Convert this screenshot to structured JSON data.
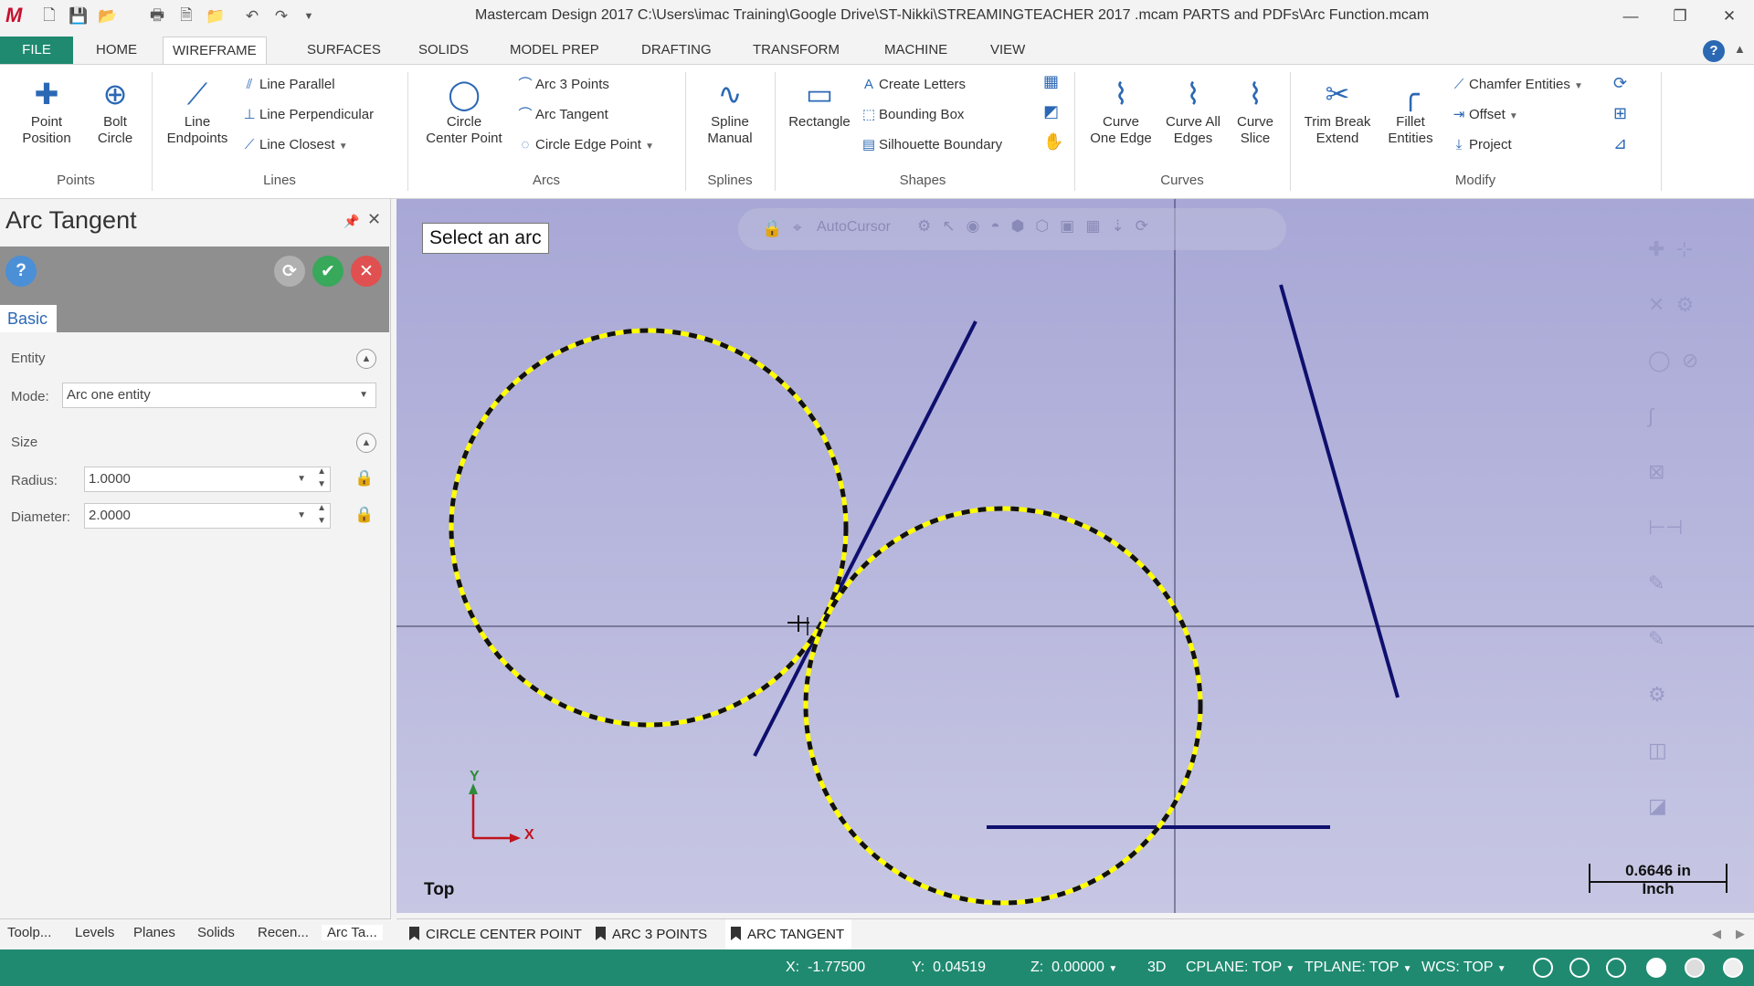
{
  "window": {
    "title": "Mastercam Design 2017  C:\\Users\\imac Training\\Google Drive\\ST-Nikki\\STREAMINGTEACHER 2017 .mcam PARTS and PDFs\\Arc Function.mcam",
    "logo": "M"
  },
  "menu": {
    "tabs": [
      "FILE",
      "HOME",
      "WIREFRAME",
      "SURFACES",
      "SOLIDS",
      "MODEL PREP",
      "DRAFTING",
      "TRANSFORM",
      "MACHINE",
      "VIEW"
    ],
    "active": "WIREFRAME"
  },
  "ribbon": {
    "points": {
      "group": "Points",
      "point_position": "Point\nPosition",
      "bolt_circle": "Bolt\nCircle"
    },
    "lines": {
      "group": "Lines",
      "line_endpoints": "Line\nEndpoints",
      "line_parallel": "Line Parallel",
      "line_perpendicular": "Line Perpendicular",
      "line_closest": "Line Closest"
    },
    "arcs": {
      "group": "Arcs",
      "circle_center_point": "Circle\nCenter Point",
      "arc_3_points": "Arc 3 Points",
      "arc_tangent": "Arc Tangent",
      "circle_edge_point": "Circle Edge Point"
    },
    "splines": {
      "group": "Splines",
      "spline_manual": "Spline\nManual"
    },
    "shapes": {
      "group": "Shapes",
      "rectangle": "Rectangle",
      "create_letters": "Create Letters",
      "bounding_box": "Bounding Box",
      "silhouette_boundary": "Silhouette Boundary"
    },
    "curves": {
      "group": "Curves",
      "curve_one_edge": "Curve\nOne Edge",
      "curve_all_edges": "Curve All\nEdges",
      "curve_slice": "Curve\nSlice"
    },
    "modify": {
      "group": "Modify",
      "trim_break_extend": "Trim Break\nExtend",
      "fillet_entities": "Fillet\nEntities",
      "chamfer_entities": "Chamfer Entities",
      "offset": "Offset",
      "project": "Project"
    }
  },
  "panel": {
    "title": "Arc Tangent",
    "tab": "Basic",
    "entity_section": "Entity",
    "mode_label": "Mode:",
    "mode_value": "Arc one entity",
    "size_section": "Size",
    "radius_label": "Radius:",
    "radius_value": "1.0000",
    "diameter_label": "Diameter:",
    "diameter_value": "2.0000"
  },
  "panel_tabs": [
    "Toolp...",
    "Levels",
    "Planes",
    "Solids",
    "Recen...",
    "Arc Ta..."
  ],
  "viewport": {
    "prompt": "Select an arc",
    "autocursor_label": "AutoCursor",
    "view_name": "Top",
    "scale_value": "0.6646 in",
    "scale_unit": "Inch",
    "axis_x": "X",
    "axis_y": "Y"
  },
  "bottom_tabs": [
    "CIRCLE CENTER POINT",
    "ARC 3 POINTS",
    "ARC TANGENT"
  ],
  "status": {
    "x_label": "X:",
    "x_value": "-1.77500",
    "y_label": "Y:",
    "y_value": "0.04519",
    "z_label": "Z:",
    "z_value": "0.00000",
    "mode": "3D",
    "cplane": "CPLANE: TOP",
    "tplane": "TPLANE: TOP",
    "wcs": "WCS: TOP"
  },
  "colors": {
    "accent": "#1f8a70",
    "geometry": "#0f0f6e",
    "selection": "#ffff00"
  }
}
